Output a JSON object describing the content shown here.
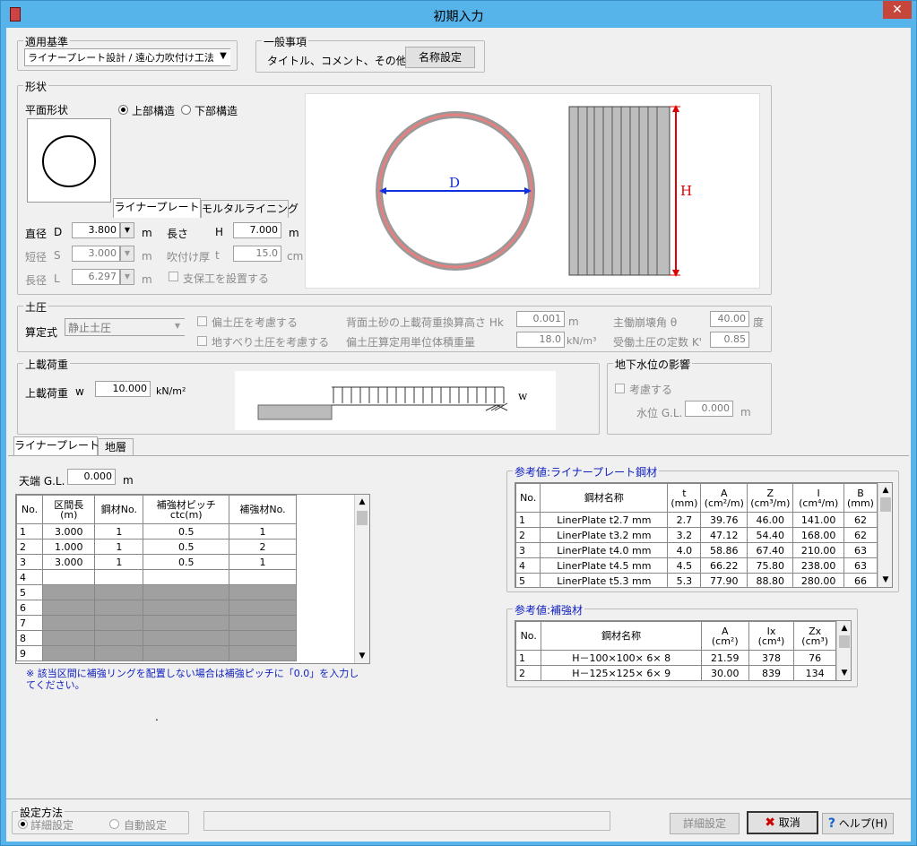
{
  "window": {
    "title": "初期入力",
    "close": "✕"
  },
  "standard": {
    "group": "適用基準",
    "value": "ライナープレート設計 / 遠心力吹付け工法"
  },
  "general": {
    "group": "一般事項",
    "label": "タイトル、コメント、その他:",
    "button": "名称設定"
  },
  "shape": {
    "group": "形状",
    "plane_label": "平面形状",
    "radio_upper": "上部構造",
    "radio_lower": "下部構造",
    "tab_liner": "ライナープレート",
    "tab_mortar": "モルタルライニング",
    "dia_label": "直径",
    "dia_sym": "D",
    "dia_val": "3.800",
    "unit_m": "m",
    "short_label": "短径",
    "short_sym": "S",
    "short_val": "3.000",
    "long_label": "長径",
    "long_sym": "L",
    "long_val": "6.297",
    "len_label": "長さ",
    "len_sym": "H",
    "len_val": "7.000",
    "spray_label": "吹付け厚",
    "spray_sym": "t",
    "spray_val": "15.0",
    "unit_cm": "cm",
    "support_chk": "支保工を設置する",
    "fig_D": "D",
    "fig_H": "H"
  },
  "earth": {
    "group": "土圧",
    "calc_label": "算定式",
    "calc_val": "静止土圧",
    "chk1": "偏土圧を考慮する",
    "chk2": "地すべり土圧を考慮する",
    "hk_label": "背面土砂の上載荷重換算高さ Hk",
    "hk_val": "0.001",
    "hk_unit": "m",
    "gamma_label": "偏土圧算定用単位体積重量",
    "gamma_val": "18.0",
    "gamma_unit": "kN/m³",
    "theta_label": "主働崩壊角 θ",
    "theta_val": "40.00",
    "theta_unit": "度",
    "k_label": "受働土圧の定数 K'",
    "k_val": "0.85"
  },
  "load": {
    "group": "上載荷重",
    "label": "上載荷重",
    "sym": "w",
    "val": "10.000",
    "unit": "kN/m²",
    "fig_w": "w"
  },
  "groundwater": {
    "group": "地下水位の影響",
    "chk": "考慮する",
    "level_label": "水位 G.L.",
    "level_val": "0.000",
    "unit": "m"
  },
  "tabs": {
    "liner": "ライナープレート",
    "strata": "地層"
  },
  "top": {
    "label": "天端 G.L.",
    "val": "0.000",
    "unit": "m"
  },
  "sections": {
    "headers": [
      "No.",
      "区間長\n(m)",
      "鋼材No.",
      "補強材ピッチ\nctc(m)",
      "補強材No."
    ],
    "rows": [
      [
        "1",
        "3.000",
        "1",
        "0.5",
        "1"
      ],
      [
        "2",
        "1.000",
        "1",
        "0.5",
        "2"
      ],
      [
        "3",
        "3.000",
        "1",
        "0.5",
        "1"
      ],
      [
        "4",
        "",
        "",
        "",
        ""
      ],
      [
        "5",
        "",
        "",
        "",
        ""
      ],
      [
        "6",
        "",
        "",
        "",
        ""
      ],
      [
        "7",
        "",
        "",
        "",
        ""
      ],
      [
        "8",
        "",
        "",
        "",
        ""
      ],
      [
        "9",
        "",
        "",
        "",
        ""
      ]
    ]
  },
  "note": "※ 該当区間に補強リングを配置しない場合は補強ピッチに「0.0」を入力してください。",
  "ref_plate": {
    "group": "参考値:ライナープレート鋼材",
    "headers": [
      "No.",
      "鋼材名称",
      "t\n(mm)",
      "A\n(cm²/m)",
      "Z\n(cm³/m)",
      "I\n(cm⁴/m)",
      "B\n(mm)"
    ],
    "rows": [
      [
        "1",
        "LinerPlate t2.7 mm",
        "2.7",
        "39.76",
        "46.00",
        "141.00",
        "62"
      ],
      [
        "2",
        "LinerPlate t3.2 mm",
        "3.2",
        "47.12",
        "54.40",
        "168.00",
        "62"
      ],
      [
        "3",
        "LinerPlate t4.0 mm",
        "4.0",
        "58.86",
        "67.40",
        "210.00",
        "63"
      ],
      [
        "4",
        "LinerPlate t4.5 mm",
        "4.5",
        "66.22",
        "75.80",
        "238.00",
        "63"
      ],
      [
        "5",
        "LinerPlate t5.3 mm",
        "5.3",
        "77.90",
        "88.80",
        "280.00",
        "66"
      ]
    ]
  },
  "ref_stiff": {
    "group": "参考値:補強材",
    "headers": [
      "No.",
      "鋼材名称",
      "A\n(cm²)",
      "Ix\n(cm⁴)",
      "Zx\n(cm³)"
    ],
    "rows": [
      [
        "1",
        "H－100×100× 6× 8",
        "21.59",
        "378",
        "76"
      ],
      [
        "2",
        "H－125×125× 6× 9",
        "30.00",
        "839",
        "134"
      ]
    ]
  },
  "method": {
    "group": "設定方法",
    "detail": "詳細設定",
    "auto": "自動設定"
  },
  "footer": {
    "detail_btn": "詳細設定",
    "cancel_btn": "取消",
    "help_btn": "ヘルプ(H)",
    "dot": "."
  }
}
